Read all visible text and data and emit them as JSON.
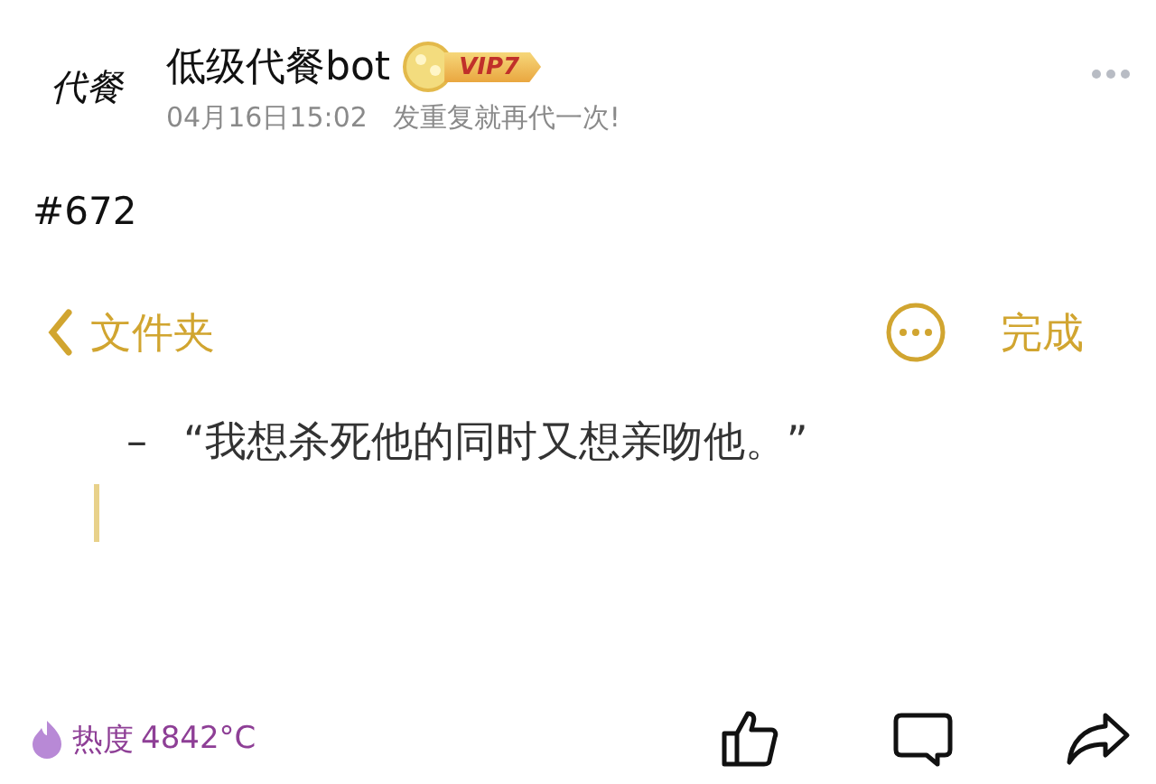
{
  "post": {
    "avatar_text": "代餐",
    "author": "低级代餐bot",
    "badge": "VIP7",
    "time": "04月16日15:02",
    "subtitle": "发重复就再代一次!",
    "number": "#672"
  },
  "note": {
    "back_label": "文件夹",
    "done_label": "完成",
    "lines": [
      {
        "kind": "bullet",
        "marker": "–",
        "text": "“我想杀死他的同时又想亲吻他。”"
      },
      {
        "kind": "cursor"
      }
    ]
  },
  "footer": {
    "heat_label": "热度",
    "heat_value": "4842°C"
  }
}
